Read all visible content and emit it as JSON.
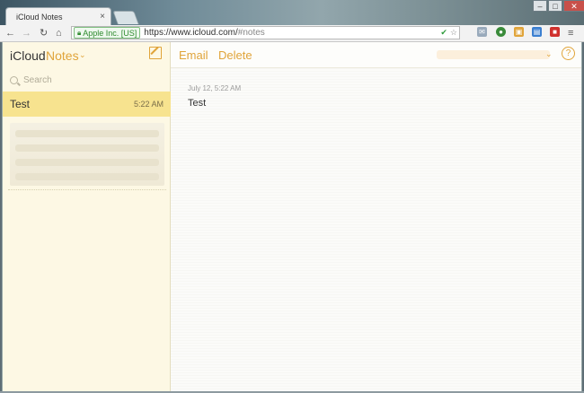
{
  "browser": {
    "tab_title": "iCloud Notes",
    "tab_close": "×",
    "ev_label": "Apple Inc. [US]",
    "url_main": "https://www.icloud.com/",
    "url_hash": "#notes",
    "min_glyph": "–",
    "max_glyph": "□",
    "close_glyph": "✕"
  },
  "sidebar": {
    "brand": "iCloud",
    "folder": "Notes",
    "search_placeholder": "Search",
    "selected_note": {
      "title": "Test",
      "time": "5:22 AM"
    }
  },
  "main": {
    "email_label": "Email",
    "delete_label": "Delete",
    "help_label": "?",
    "note_date": "July 12, 5:22 AM",
    "note_body": "Test"
  },
  "colors": {
    "accent": "#e0a43a",
    "selected_note": "#f7e38f",
    "sidebar_bg": "#fdf8e4"
  }
}
